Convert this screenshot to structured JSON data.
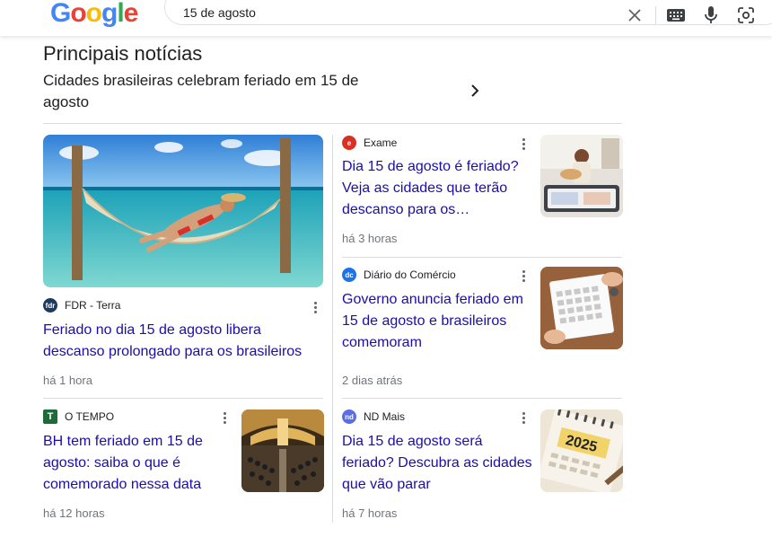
{
  "header": {
    "logo": [
      "G",
      "o",
      "o",
      "g",
      "l",
      "e"
    ],
    "logo_colors": [
      "#4285F4",
      "#EA4335",
      "#FBBC05",
      "#4285F4",
      "#34A853",
      "#EA4335"
    ],
    "query": "15 de agosto",
    "icons": [
      "clear-icon",
      "keyboard-icon",
      "microphone-icon",
      "lens-icon"
    ]
  },
  "section": {
    "title": "Principais notícias",
    "subtitle": "Cidades brasileiras celebram feriado em 15 de agosto"
  },
  "articles": [
    {
      "source": "FDR - Terra",
      "favicon_text": "fdr",
      "favicon_color": "#1f3b5c",
      "headline": "Feriado no dia 15 de agosto libera descanso prolongado para os brasileiros",
      "time": "há 1 hora",
      "image": "hammock-beach-image"
    },
    {
      "source": "Exame",
      "favicon_text": "e",
      "favicon_color": "#d93025",
      "headline": "Dia 15 de agosto é feriado? Veja as cidades que terão descanso para os…",
      "time": "há 3 horas",
      "image": "woman-suitcase-image"
    },
    {
      "source": "Diário do Comércio",
      "favicon_text": "dc",
      "favicon_color": "#1a73e8",
      "headline": "Governo anuncia feriado em 15 de agosto e brasileiros comemoram",
      "time": "2 dias atrás",
      "image": "calendar-hands-image"
    },
    {
      "source": "O TEMPO",
      "favicon_text": "T",
      "favicon_color": "#1e6b3a",
      "headline": "BH tem feriado em 15 de agosto: saiba o que é comemorado nessa data",
      "time": "há 12 horas",
      "image": "church-interior-image"
    },
    {
      "source": "ND Mais",
      "favicon_text": "nd",
      "favicon_color": "#5b6ee1",
      "headline": "Dia 15 de agosto será feriado? Descubra as cidades que vão parar",
      "time": "há 7 horas",
      "image": "calendar-2025-image",
      "image_text": "2025"
    }
  ]
}
